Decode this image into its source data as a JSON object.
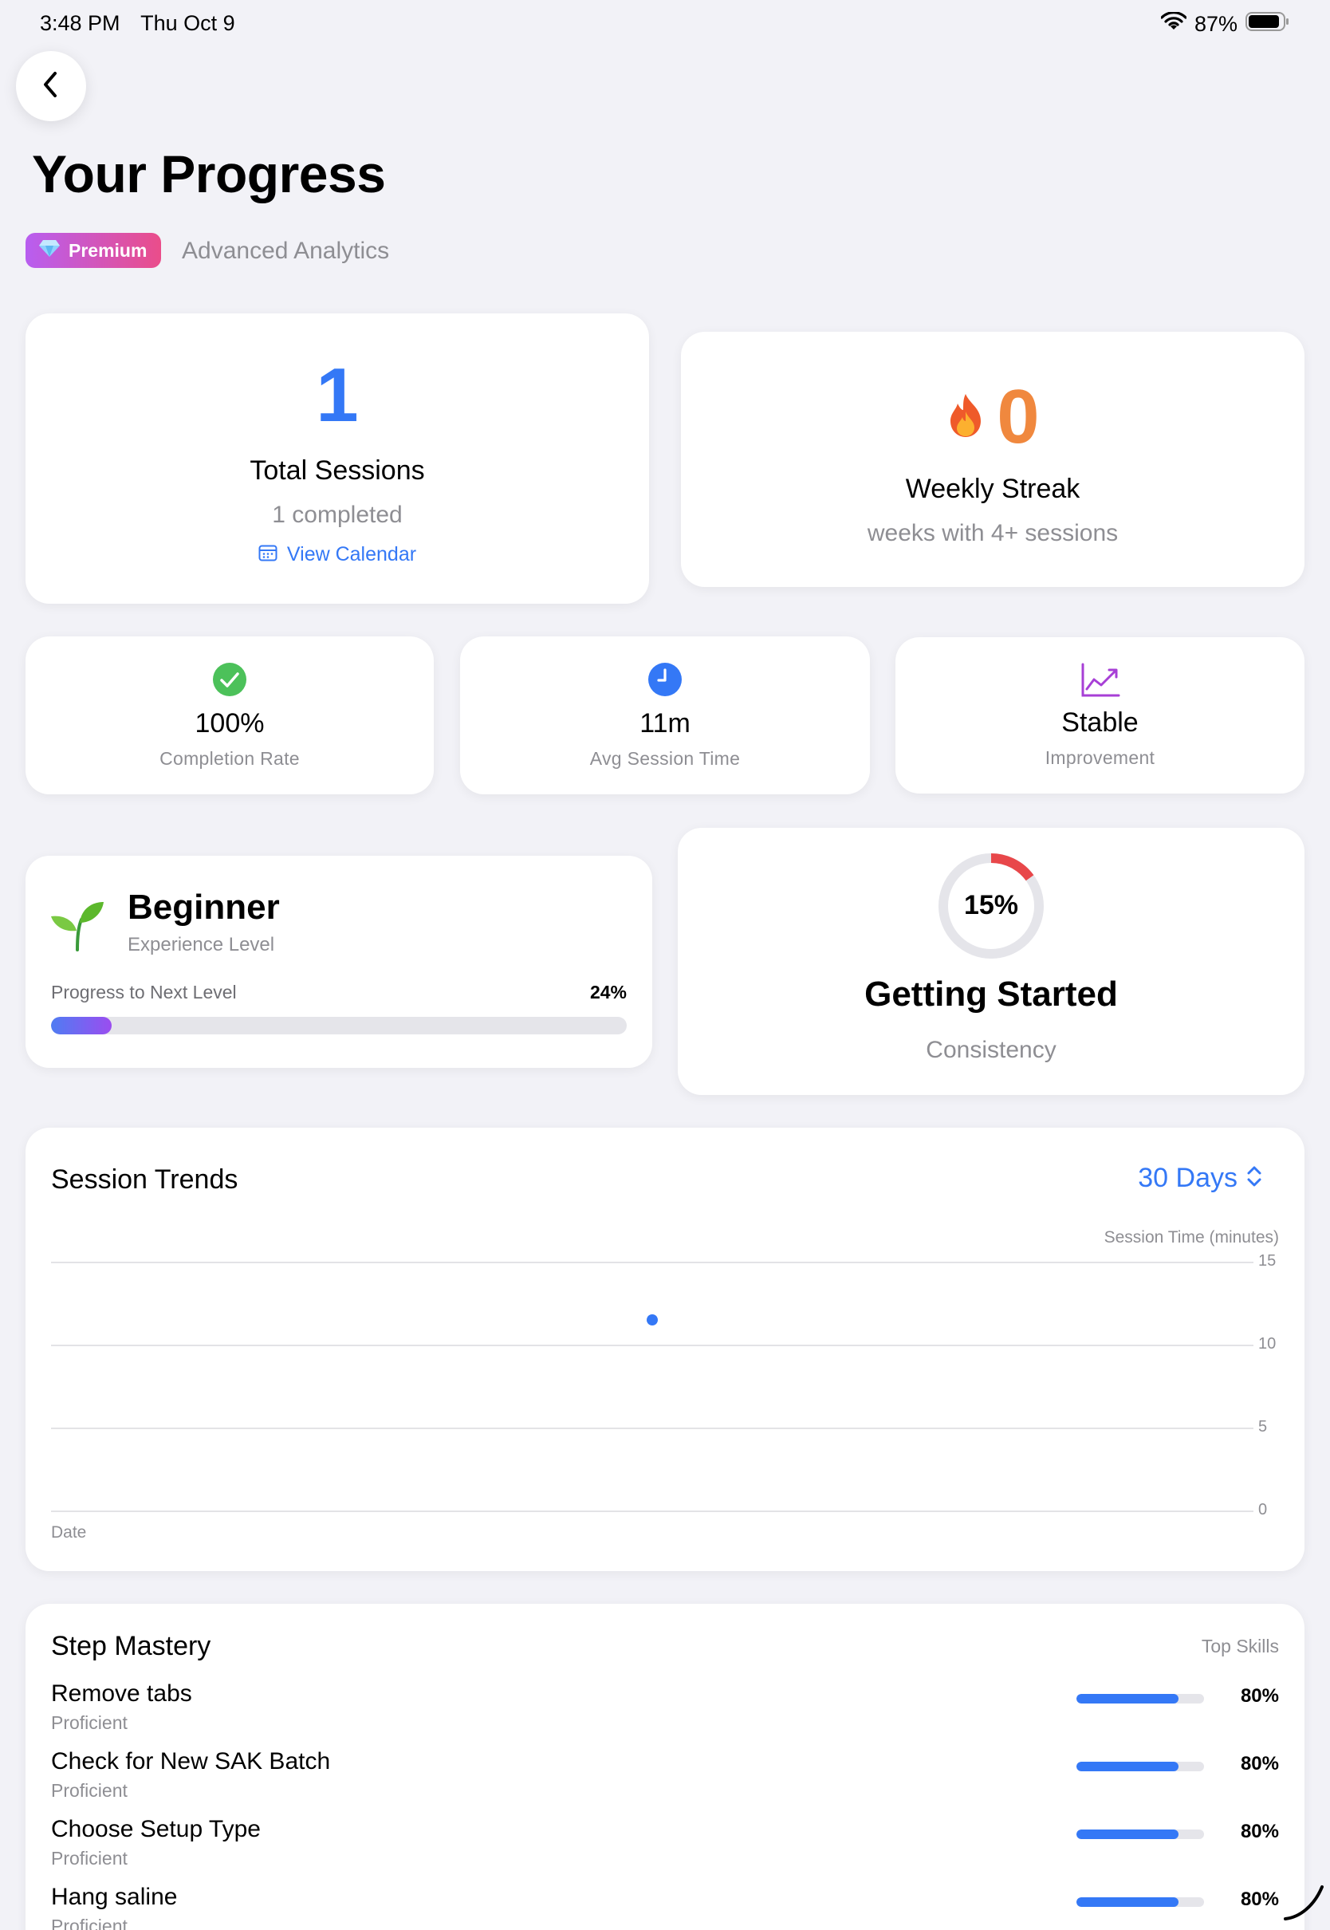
{
  "status_bar": {
    "time": "3:48 PM",
    "date": "Thu Oct 9",
    "battery": "87%"
  },
  "header": {
    "title": "Your Progress",
    "badge": "Premium",
    "subtitle": "Advanced Analytics"
  },
  "total_sessions": {
    "value": "1",
    "title": "Total Sessions",
    "sub": "1 completed",
    "link": "View Calendar"
  },
  "weekly_streak": {
    "value": "0",
    "title": "Weekly Streak",
    "sub": "weeks with 4+ sessions"
  },
  "stats": [
    {
      "value": "100%",
      "label": "Completion Rate",
      "icon": "check-circle-icon"
    },
    {
      "value": "11m",
      "label": "Avg Session Time",
      "icon": "clock-icon"
    },
    {
      "value": "Stable",
      "label": "Improvement",
      "icon": "trend-chart-icon"
    }
  ],
  "experience": {
    "level": "Beginner",
    "level_label": "Experience Level",
    "progress_label": "Progress to Next Level",
    "progress_pct": "24%",
    "progress_value": 0.105
  },
  "consistency": {
    "pct": "15%",
    "value": 0.15,
    "title": "Getting Started",
    "sub": "Consistency"
  },
  "trends": {
    "title": "Session Trends",
    "range": "30 Days"
  },
  "chart_data": {
    "type": "scatter",
    "ylabel": "Session Time (minutes)",
    "xlabel": "Date",
    "ylim": [
      0,
      15
    ],
    "yticks": [
      "15",
      "10",
      "5",
      "0"
    ],
    "points": [
      {
        "x": 0.5,
        "y": 11.5
      }
    ]
  },
  "mastery": {
    "title": "Step Mastery",
    "right_label": "Top Skills",
    "skills": [
      {
        "name": "Remove tabs",
        "level": "Proficient",
        "pct": "80%",
        "value": 0.8
      },
      {
        "name": "Check for New SAK Batch",
        "level": "Proficient",
        "pct": "80%",
        "value": 0.8
      },
      {
        "name": "Choose Setup Type",
        "level": "Proficient",
        "pct": "80%",
        "value": 0.8
      },
      {
        "name": "Hang saline",
        "level": "Proficient",
        "pct": "80%",
        "value": 0.8
      }
    ]
  },
  "colors": {
    "accent": "#3478f6",
    "streak_orange": "#f0883e",
    "success": "#4cc15a",
    "consistency_red": "#e8474a",
    "purple": "#a73fd6"
  }
}
